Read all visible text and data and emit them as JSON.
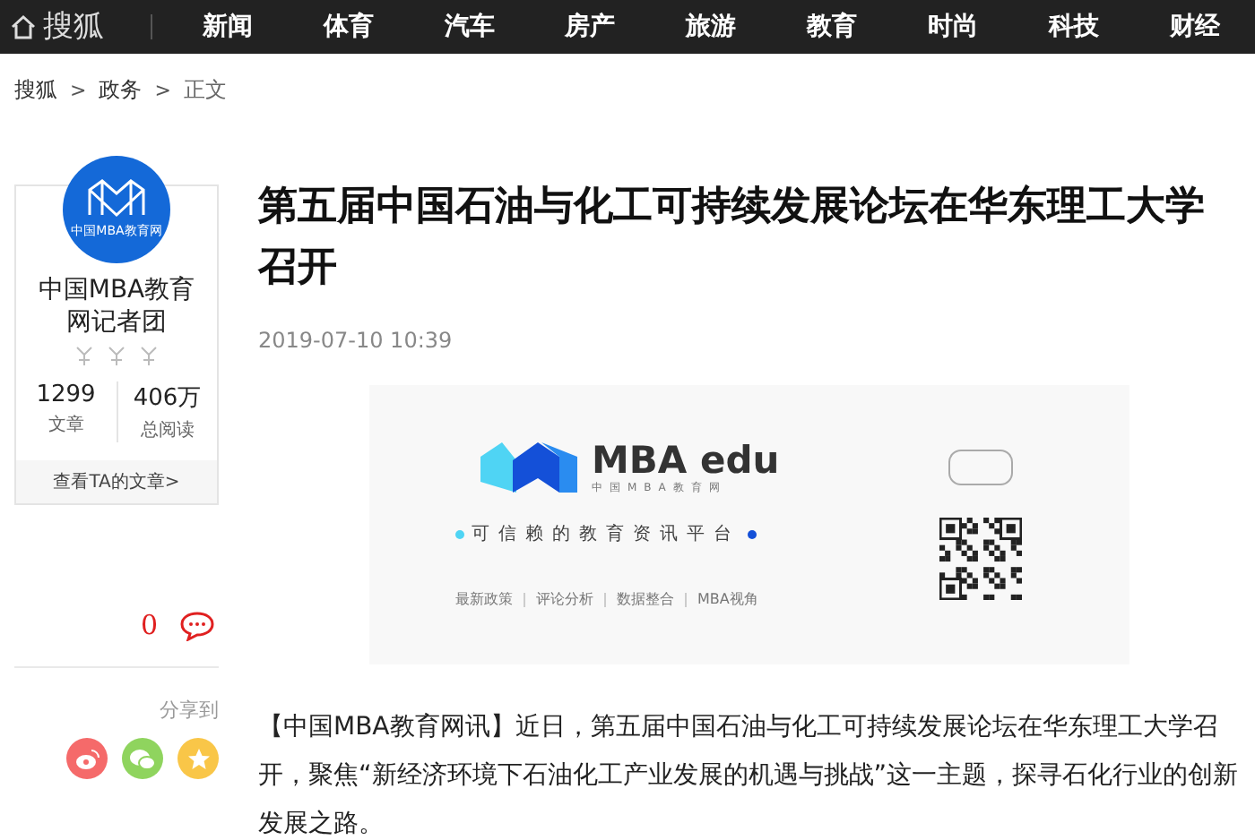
{
  "nav": {
    "logo": "搜狐",
    "items": [
      "新闻",
      "体育",
      "汽车",
      "房产",
      "旅游",
      "教育",
      "时尚",
      "科技",
      "财经"
    ]
  },
  "breadcrumb": [
    {
      "text": "搜狐"
    },
    {
      "separator": ">",
      "text": "政务"
    },
    {
      "separator": ">",
      "text": "正文"
    }
  ],
  "author": {
    "avatar_text": "中国MBA教育网",
    "name": "中国MBA教育网记者团",
    "stats": [
      {
        "value": "1299",
        "label": "文章"
      },
      {
        "value": "406万",
        "label": "总阅读"
      }
    ],
    "more_link": "查看TA的文章>"
  },
  "comments": {
    "count": "0"
  },
  "share": {
    "label": "分享到",
    "targets": [
      {
        "kind": "weibo",
        "color": "#f56a6a"
      },
      {
        "kind": "wechat",
        "color": "#8fd45e"
      },
      {
        "kind": "qzone",
        "color": "#f9c648"
      }
    ]
  },
  "article": {
    "title": "第五届中国石油与化工可持续发展论坛在华东理工大学召开",
    "date": "2019-07-10 10:39",
    "banner": {
      "brand": "MBA edu",
      "brand_sub": "中国MBA教育网",
      "slogan": "可信赖的教育资讯平台",
      "links": [
        "最新政策",
        "评论分析",
        "数据整合",
        "MBA视角"
      ]
    },
    "body": "【中国MBA教育网讯】近日，第五届中国石油与化工可持续发展论坛在华东理工大学召开，聚焦“新经济环境下石油化工产业发展的机遇与挑战”这一主题，探寻石化行业的创新发展之路。"
  }
}
